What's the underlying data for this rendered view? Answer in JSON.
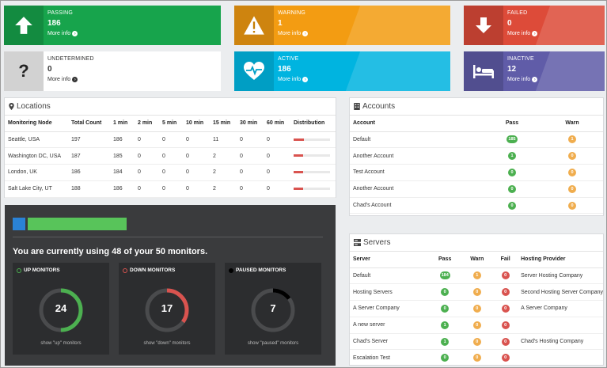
{
  "tiles": [
    {
      "label": "PASSING",
      "value": "186",
      "more": "More info",
      "icon": "arrow-up-icon",
      "color": "#17a44c"
    },
    {
      "label": "WARNING",
      "value": "1",
      "more": "More info",
      "icon": "warning-icon",
      "color": "#f39c12"
    },
    {
      "label": "FAILED",
      "value": "0",
      "more": "More info",
      "icon": "arrow-down-icon",
      "color": "#dd4b39"
    },
    {
      "label": "UNDETERMINED",
      "value": "0",
      "more": "More info",
      "icon": "question-icon",
      "color": "#d2d2d2"
    },
    {
      "label": "ACTIVE",
      "value": "186",
      "more": "More info",
      "icon": "heartbeat-icon",
      "color": "#00b4e0"
    },
    {
      "label": "INACTIVE",
      "value": "12",
      "more": "More info",
      "icon": "bed-icon",
      "color": "#605ca8"
    }
  ],
  "locations": {
    "title": "Locations",
    "headers": [
      "Monitoring Node",
      "Total Count",
      "1 min",
      "2 min",
      "5 min",
      "10 min",
      "15 min",
      "30 min",
      "60 min",
      "Distribution"
    ],
    "rows": [
      {
        "node": "Seattle, USA",
        "total": "197",
        "m1": "186",
        "m2": "0",
        "m5": "0",
        "m10": "0",
        "m15": "11",
        "m30": "0",
        "m60": "0",
        "dist": 0.28
      },
      {
        "node": "Washington DC, USA",
        "total": "187",
        "m1": "185",
        "m2": "0",
        "m5": "0",
        "m10": "0",
        "m15": "2",
        "m30": "0",
        "m60": "0",
        "dist": 0.26
      },
      {
        "node": "London, UK",
        "total": "186",
        "m1": "184",
        "m2": "0",
        "m5": "0",
        "m10": "0",
        "m15": "2",
        "m30": "0",
        "m60": "0",
        "dist": 0.26
      },
      {
        "node": "Salt Lake City, UT",
        "total": "188",
        "m1": "186",
        "m2": "0",
        "m5": "0",
        "m10": "0",
        "m15": "2",
        "m30": "0",
        "m60": "0",
        "dist": 0.26
      }
    ]
  },
  "accounts": {
    "title": "Accounts",
    "headers": [
      "Account",
      "Pass",
      "Warn"
    ],
    "rows": [
      {
        "name": "Default",
        "pass": "185",
        "warn": "1"
      },
      {
        "name": "Another Account",
        "pass": "1",
        "warn": "0"
      },
      {
        "name": "Test Account",
        "pass": "0",
        "warn": "0"
      },
      {
        "name": "Another Account",
        "pass": "0",
        "warn": "0"
      },
      {
        "name": "Chad's Account",
        "pass": "0",
        "warn": "0"
      }
    ]
  },
  "servers": {
    "title": "Servers",
    "headers": [
      "Server",
      "Pass",
      "Warn",
      "Fail",
      "Hosting Provider"
    ],
    "rows": [
      {
        "name": "Default",
        "pass": "184",
        "warn": "1",
        "fail": "0",
        "provider": "Server Hosting Company"
      },
      {
        "name": "Hosting Servers",
        "pass": "0",
        "warn": "0",
        "fail": "0",
        "provider": "Second Hosting Server Company"
      },
      {
        "name": "A Server Company",
        "pass": "0",
        "warn": "0",
        "fail": "0",
        "provider": "A Server Company"
      },
      {
        "name": "A new server",
        "pass": "1",
        "warn": "0",
        "fail": "0",
        "provider": ""
      },
      {
        "name": "Chad's Server",
        "pass": "1",
        "warn": "0",
        "fail": "0",
        "provider": "Chad's Hosting Company"
      },
      {
        "name": "Escalation Test",
        "pass": "0",
        "warn": "0",
        "fail": "0",
        "provider": ""
      }
    ]
  },
  "usage": {
    "text": "You are currently using 48 of your 50 monitors.",
    "used": 48,
    "limit": 50
  },
  "monitors": [
    {
      "label": "UP MONITORS",
      "count": "24",
      "show": "show \"up\" monitors",
      "color": "#4cb050",
      "fraction": 0.5
    },
    {
      "label": "DOWN MONITORS",
      "count": "17",
      "show": "show \"down\" monitors",
      "color": "#d9534f",
      "fraction": 0.35
    },
    {
      "label": "PAUSED MONITORS",
      "count": "7",
      "show": "show \"paused\" monitors",
      "color": "#000000",
      "fraction": 0.15
    }
  ],
  "colors": {
    "pass": "#4cb050",
    "warn": "#f0ad4e",
    "fail": "#d9534f",
    "dist": "#d9534f"
  }
}
